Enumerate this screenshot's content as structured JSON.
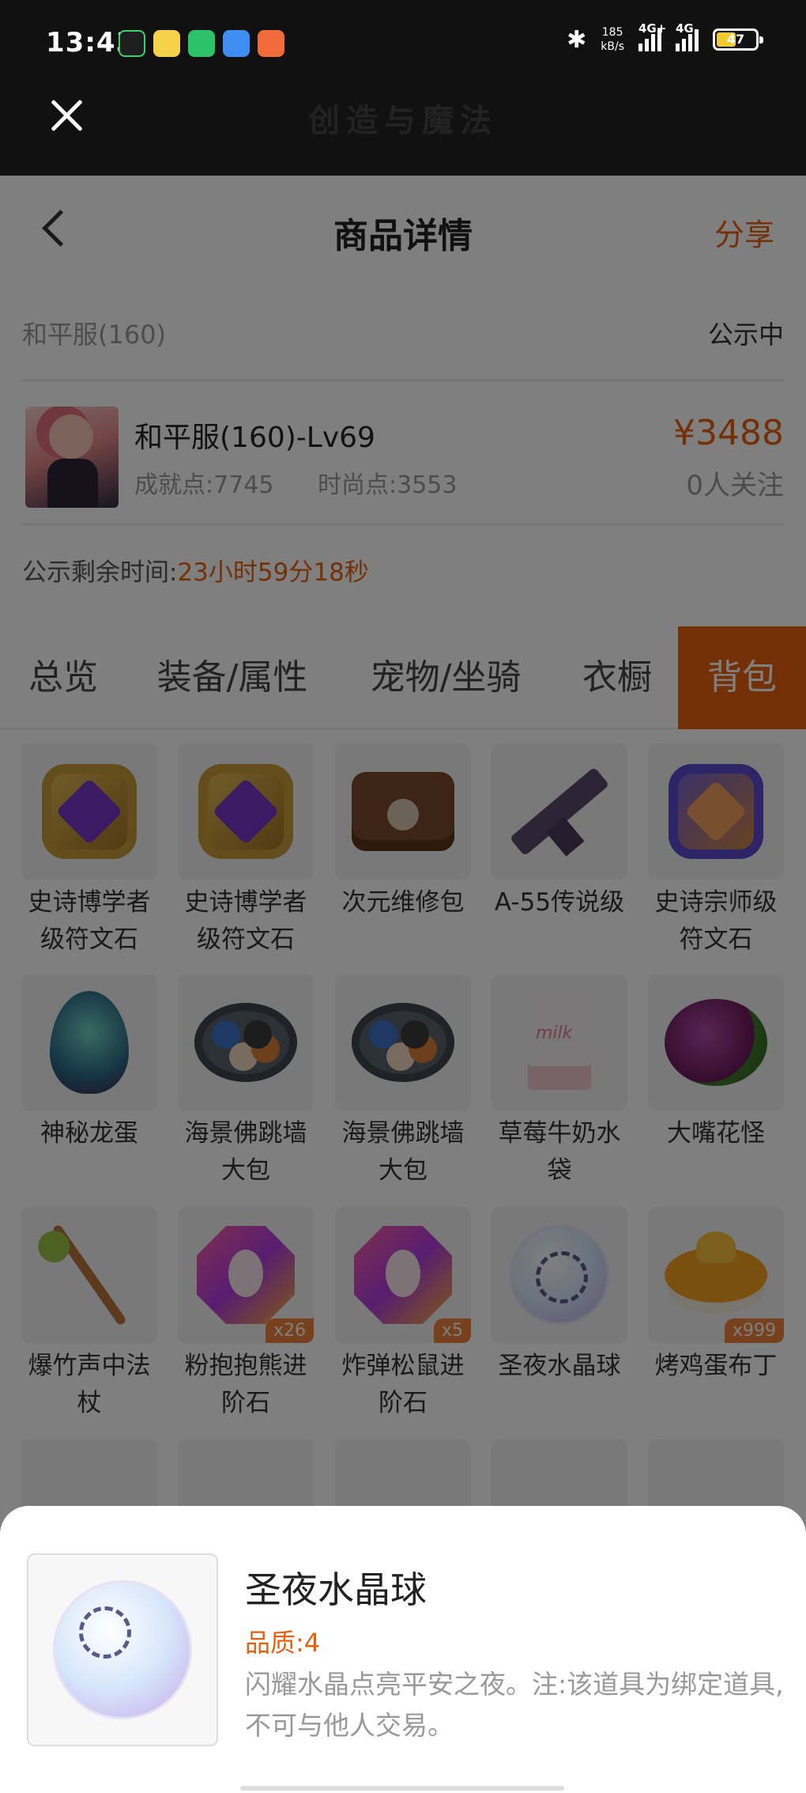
{
  "status_bar": {
    "time": "13:43",
    "speed_value": "185",
    "speed_unit": "kB/s",
    "net1": "4G+",
    "net2": "4G",
    "battery": "47"
  },
  "app_header": {
    "title": "创造与魔法"
  },
  "nav": {
    "title": "商品详情",
    "share": "分享"
  },
  "listing": {
    "server": "和平服(160)",
    "status": "公示中",
    "product_name": "和平服(160)-Lv69",
    "achievement": "成就点:7745",
    "fashion": "时尚点:3553",
    "price": "¥3488",
    "followers": "0人关注",
    "timer_label": "公示剩余时间:",
    "timer_value": "23小时59分18秒"
  },
  "tabs": [
    {
      "label": "总览"
    },
    {
      "label": "装备/属性"
    },
    {
      "label": "宠物/坐骑"
    },
    {
      "label": "衣橱"
    },
    {
      "label": "背包"
    }
  ],
  "active_tab": "背包",
  "items": [
    {
      "name": "史诗博学者级符文石",
      "icon": "rune-stone-icon",
      "badge": ""
    },
    {
      "name": "史诗博学者级符文石",
      "icon": "rune-stone-icon",
      "badge": ""
    },
    {
      "name": "次元维修包",
      "icon": "repair-bag-icon",
      "badge": ""
    },
    {
      "name": "A-55传说级",
      "icon": "rifle-icon",
      "badge": ""
    },
    {
      "name": "史诗宗师级符文石",
      "icon": "rune-stone-icon",
      "badge": ""
    },
    {
      "name": "神秘龙蛋",
      "icon": "dragon-egg-icon",
      "badge": ""
    },
    {
      "name": "海景佛跳墙大包",
      "icon": "buns-icon",
      "badge": ""
    },
    {
      "name": "海景佛跳墙大包",
      "icon": "buns-icon",
      "badge": ""
    },
    {
      "name": "草莓牛奶水袋",
      "icon": "milk-bag-icon",
      "badge": ""
    },
    {
      "name": "大嘴花怪",
      "icon": "plant-monster-icon",
      "badge": ""
    },
    {
      "name": "爆竹声中法杖",
      "icon": "staff-icon",
      "badge": ""
    },
    {
      "name": "粉抱抱熊进阶石",
      "icon": "gem-icon",
      "badge": "x26"
    },
    {
      "name": "炸弹松鼠进阶石",
      "icon": "gem-icon",
      "badge": "x5"
    },
    {
      "name": "圣夜水晶球",
      "icon": "crystal-ball-icon",
      "badge": ""
    },
    {
      "name": "烤鸡蛋布丁",
      "icon": "pudding-icon",
      "badge": "x999"
    }
  ],
  "detail_sheet": {
    "name": "圣夜水晶球",
    "quality": "品质:4",
    "description": "闪耀水晶点亮平安之夜。注:该道具为绑定道具,不可与他人交易。",
    "icon": "crystal-ball-icon"
  },
  "colors": {
    "accent": "#e8600c",
    "header_bg": "#111111"
  }
}
